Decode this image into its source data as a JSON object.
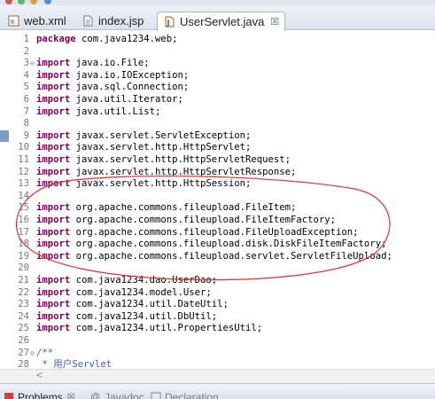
{
  "tabs": [
    {
      "label": "web.xml",
      "icon": "xml-file-icon",
      "active": false
    },
    {
      "label": "index.jsp",
      "icon": "jsp-file-icon",
      "active": false
    },
    {
      "label": "UserServlet.java",
      "icon": "java-file-icon",
      "active": true,
      "close": "☒"
    }
  ],
  "editor": {
    "lines": [
      {
        "n": "1",
        "kw": "package",
        "rest": " com.java1234.web;"
      },
      {
        "n": "2",
        "kw": "",
        "rest": ""
      },
      {
        "n": "3",
        "kw": "import",
        "rest": " java.io.File;",
        "fold": "⊖"
      },
      {
        "n": "4",
        "kw": "import",
        "rest": " java.io.IOException;"
      },
      {
        "n": "5",
        "kw": "import",
        "rest": " java.sql.Connection;"
      },
      {
        "n": "6",
        "kw": "import",
        "rest": " java.util.Iterator;"
      },
      {
        "n": "7",
        "kw": "import",
        "rest": " java.util.List;"
      },
      {
        "n": "8",
        "kw": "",
        "rest": ""
      },
      {
        "n": "9",
        "kw": "import",
        "rest": " javax.servlet.ServletException;",
        "marker": true
      },
      {
        "n": "10",
        "kw": "import",
        "rest": " javax.servlet.http.HttpServlet;"
      },
      {
        "n": "11",
        "kw": "import",
        "rest": " javax.servlet.http.HttpServletRequest;"
      },
      {
        "n": "12",
        "kw": "import",
        "rest": " javax.servlet.http.HttpServletResponse;"
      },
      {
        "n": "13",
        "kw": "import",
        "rest": " javax.servlet.http.HttpSession;"
      },
      {
        "n": "14",
        "kw": "",
        "rest": ""
      },
      {
        "n": "15",
        "kw": "import",
        "rest": " org.apache.commons.fileupload.FileItem;"
      },
      {
        "n": "16",
        "kw": "import",
        "rest": " org.apache.commons.fileupload.FileItemFactory;"
      },
      {
        "n": "17",
        "kw": "import",
        "rest": " org.apache.commons.fileupload.FileUploadException;"
      },
      {
        "n": "18",
        "kw": "import",
        "rest": " org.apache.commons.fileupload.disk.DiskFileItemFactory;"
      },
      {
        "n": "19",
        "kw": "import",
        "rest": " org.apache.commons.fileupload.servlet.ServletFileUpload;"
      },
      {
        "n": "20",
        "kw": "",
        "rest": ""
      },
      {
        "n": "21",
        "kw": "import",
        "rest": " com.java1234.dao.UserDao;"
      },
      {
        "n": "22",
        "kw": "import",
        "rest": " com.java1234.model.User;"
      },
      {
        "n": "23",
        "kw": "import",
        "rest": " com.java1234.util.DateUtil;"
      },
      {
        "n": "24",
        "kw": "import",
        "rest": " com.java1234.util.DbUtil;"
      },
      {
        "n": "25",
        "kw": "import",
        "rest": " com.java1234.util.PropertiesUtil;"
      },
      {
        "n": "26",
        "kw": "",
        "rest": ""
      },
      {
        "n": "27",
        "kw": "",
        "rest": "",
        "comment": "/**",
        "fold": "⊖"
      },
      {
        "n": "28",
        "kw": "",
        "rest": "",
        "comment": " * 用户Servlet"
      }
    ]
  },
  "scroll": {
    "left_arrow": "<"
  },
  "bottom_tabs": [
    {
      "label": "Problems",
      "extra": "☒",
      "icon": "problems-icon",
      "dim": false
    },
    {
      "label": "Javadoc",
      "icon": "javadoc-icon",
      "dim": true
    },
    {
      "label": "Declaration",
      "icon": "declaration-icon",
      "dim": true
    }
  ],
  "colors": {
    "keyword": "#7f0055",
    "comment": "#3f5fbf",
    "annotation": "#e03030",
    "marker": "#7c9ac6"
  }
}
